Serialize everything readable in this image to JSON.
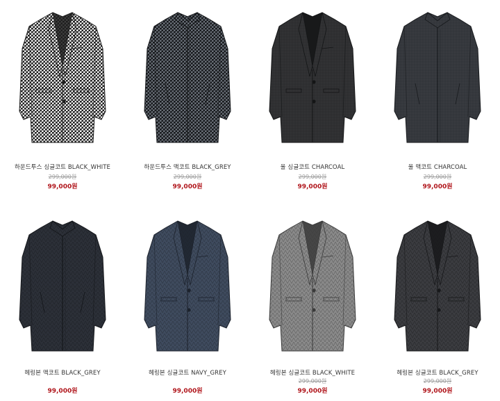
{
  "products": [
    {
      "name": "하운드투스 싱글코트 BLACK_WHITE",
      "original_price": "299,000원",
      "sale_price": "99,000원",
      "style": "single",
      "fabric": "houndstooth-bw",
      "base": "#cfcfcf",
      "dark": "#1e1e1e"
    },
    {
      "name": "하운드투스 맥코트 BLACK_GREY",
      "original_price": "299,000원",
      "sale_price": "99,000원",
      "style": "mac",
      "fabric": "houndstooth-grey",
      "base": "#3b3f45",
      "dark": "#16181b"
    },
    {
      "name": "울 싱글코트 CHARCOAL",
      "original_price": "299,000원",
      "sale_price": "99,000원",
      "style": "single",
      "fabric": "solid",
      "base": "#2f3032",
      "dark": "#141516"
    },
    {
      "name": "울 맥코트 CHARCOAL",
      "original_price": "299,000원",
      "sale_price": "99,000원",
      "style": "mac",
      "fabric": "solid",
      "base": "#35383d",
      "dark": "#181a1d"
    },
    {
      "name": "헤링본 맥코트 BLACK_GREY",
      "original_price": "",
      "sale_price": "99,000원",
      "style": "mac",
      "fabric": "herringbone",
      "base": "#2c3038",
      "dark": "#14161a"
    },
    {
      "name": "헤링본 싱글코트 NAVY_GREY",
      "original_price": "",
      "sale_price": "99,000원",
      "style": "single",
      "fabric": "herringbone",
      "base": "#3f4b5e",
      "dark": "#1c222c"
    },
    {
      "name": "헤링본 싱글코트 BLACK_WHITE",
      "original_price": "299,000원",
      "sale_price": "99,000원",
      "style": "single",
      "fabric": "herringbone",
      "base": "#8a8a8a",
      "dark": "#3a3a3a"
    },
    {
      "name": "헤링본 싱글코트 BLACK_GREY",
      "original_price": "299,000원",
      "sale_price": "99,000원",
      "style": "single",
      "fabric": "herringbone",
      "base": "#3b3c40",
      "dark": "#17181a"
    }
  ]
}
